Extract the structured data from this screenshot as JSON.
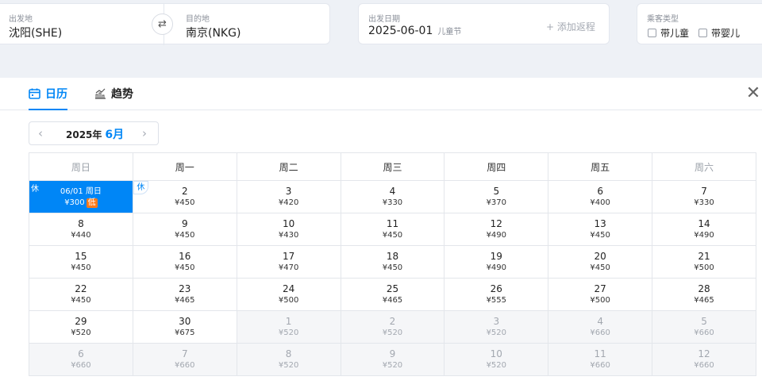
{
  "search": {
    "origin_label": "出发地",
    "origin_value": "沈阳(SHE)",
    "dest_label": "目的地",
    "dest_value": "南京(NKG)",
    "date_label": "出发日期",
    "date_value": "2025-06-01",
    "date_holiday": "儿童节",
    "add_return": "+ 添加返程",
    "passenger_label": "乘客类型",
    "with_child": "带儿童",
    "with_infant": "带婴儿"
  },
  "tabs": [
    {
      "label": "日历",
      "icon": "calendar-icon",
      "active": true
    },
    {
      "label": "趋势",
      "icon": "trend-chart-icon",
      "active": false
    }
  ],
  "month_nav": {
    "year": "2025年",
    "month": "6月"
  },
  "weekdays": [
    "周日",
    "周一",
    "周二",
    "周三",
    "周四",
    "周五",
    "周六"
  ],
  "selected": {
    "date": "06/01 周日",
    "price": "¥300",
    "tag": "低",
    "badge": "休"
  },
  "rest_badge": "休",
  "weeks": [
    [
      {
        "day": "",
        "price": "",
        "selected": true
      },
      {
        "day": "2",
        "price": "¥450",
        "rest": true
      },
      {
        "day": "3",
        "price": "¥420"
      },
      {
        "day": "4",
        "price": "¥330"
      },
      {
        "day": "5",
        "price": "¥370"
      },
      {
        "day": "6",
        "price": "¥400"
      },
      {
        "day": "7",
        "price": "¥330"
      }
    ],
    [
      {
        "day": "8",
        "price": "¥440"
      },
      {
        "day": "9",
        "price": "¥450"
      },
      {
        "day": "10",
        "price": "¥430"
      },
      {
        "day": "11",
        "price": "¥450"
      },
      {
        "day": "12",
        "price": "¥490"
      },
      {
        "day": "13",
        "price": "¥450"
      },
      {
        "day": "14",
        "price": "¥490"
      }
    ],
    [
      {
        "day": "15",
        "price": "¥450"
      },
      {
        "day": "16",
        "price": "¥450"
      },
      {
        "day": "17",
        "price": "¥470"
      },
      {
        "day": "18",
        "price": "¥450"
      },
      {
        "day": "19",
        "price": "¥490"
      },
      {
        "day": "20",
        "price": "¥450"
      },
      {
        "day": "21",
        "price": "¥500"
      }
    ],
    [
      {
        "day": "22",
        "price": "¥450"
      },
      {
        "day": "23",
        "price": "¥465"
      },
      {
        "day": "24",
        "price": "¥500"
      },
      {
        "day": "25",
        "price": "¥465"
      },
      {
        "day": "26",
        "price": "¥555"
      },
      {
        "day": "27",
        "price": "¥500"
      },
      {
        "day": "28",
        "price": "¥465"
      }
    ],
    [
      {
        "day": "29",
        "price": "¥520"
      },
      {
        "day": "30",
        "price": "¥675"
      },
      {
        "day": "1",
        "price": "¥520",
        "other": true
      },
      {
        "day": "2",
        "price": "¥520",
        "other": true
      },
      {
        "day": "3",
        "price": "¥520",
        "other": true
      },
      {
        "day": "4",
        "price": "¥660",
        "other": true
      },
      {
        "day": "5",
        "price": "¥660",
        "other": true
      }
    ],
    [
      {
        "day": "6",
        "price": "¥660",
        "other": true
      },
      {
        "day": "7",
        "price": "¥660",
        "other": true
      },
      {
        "day": "8",
        "price": "¥520",
        "other": true
      },
      {
        "day": "9",
        "price": "¥520",
        "other": true
      },
      {
        "day": "10",
        "price": "¥520",
        "other": true
      },
      {
        "day": "11",
        "price": "¥660",
        "other": true
      },
      {
        "day": "12",
        "price": "¥660",
        "other": true
      }
    ]
  ],
  "colors": {
    "accent": "#0086f6",
    "low_tag": "#ff7a1a",
    "other_month_bg": "#f5f6f8"
  }
}
